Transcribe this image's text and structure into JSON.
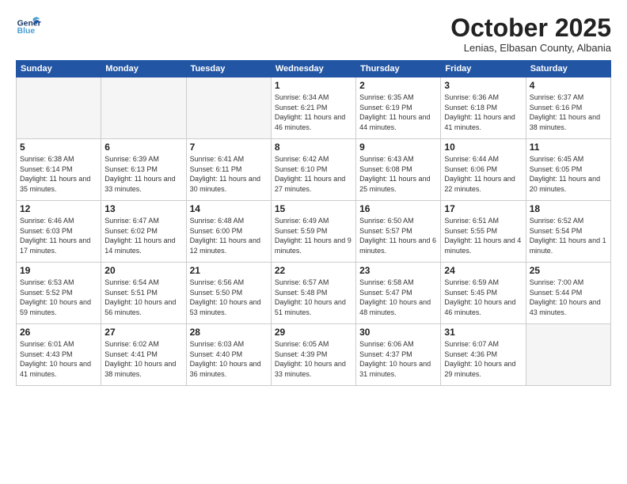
{
  "header": {
    "logo_general": "General",
    "logo_blue": "Blue",
    "month": "October 2025",
    "location": "Lenias, Elbasan County, Albania"
  },
  "weekdays": [
    "Sunday",
    "Monday",
    "Tuesday",
    "Wednesday",
    "Thursday",
    "Friday",
    "Saturday"
  ],
  "weeks": [
    [
      {
        "day": "",
        "sunrise": "",
        "sunset": "",
        "daylight": ""
      },
      {
        "day": "",
        "sunrise": "",
        "sunset": "",
        "daylight": ""
      },
      {
        "day": "",
        "sunrise": "",
        "sunset": "",
        "daylight": ""
      },
      {
        "day": "1",
        "sunrise": "Sunrise: 6:34 AM",
        "sunset": "Sunset: 6:21 PM",
        "daylight": "Daylight: 11 hours and 46 minutes."
      },
      {
        "day": "2",
        "sunrise": "Sunrise: 6:35 AM",
        "sunset": "Sunset: 6:19 PM",
        "daylight": "Daylight: 11 hours and 44 minutes."
      },
      {
        "day": "3",
        "sunrise": "Sunrise: 6:36 AM",
        "sunset": "Sunset: 6:18 PM",
        "daylight": "Daylight: 11 hours and 41 minutes."
      },
      {
        "day": "4",
        "sunrise": "Sunrise: 6:37 AM",
        "sunset": "Sunset: 6:16 PM",
        "daylight": "Daylight: 11 hours and 38 minutes."
      }
    ],
    [
      {
        "day": "5",
        "sunrise": "Sunrise: 6:38 AM",
        "sunset": "Sunset: 6:14 PM",
        "daylight": "Daylight: 11 hours and 35 minutes."
      },
      {
        "day": "6",
        "sunrise": "Sunrise: 6:39 AM",
        "sunset": "Sunset: 6:13 PM",
        "daylight": "Daylight: 11 hours and 33 minutes."
      },
      {
        "day": "7",
        "sunrise": "Sunrise: 6:41 AM",
        "sunset": "Sunset: 6:11 PM",
        "daylight": "Daylight: 11 hours and 30 minutes."
      },
      {
        "day": "8",
        "sunrise": "Sunrise: 6:42 AM",
        "sunset": "Sunset: 6:10 PM",
        "daylight": "Daylight: 11 hours and 27 minutes."
      },
      {
        "day": "9",
        "sunrise": "Sunrise: 6:43 AM",
        "sunset": "Sunset: 6:08 PM",
        "daylight": "Daylight: 11 hours and 25 minutes."
      },
      {
        "day": "10",
        "sunrise": "Sunrise: 6:44 AM",
        "sunset": "Sunset: 6:06 PM",
        "daylight": "Daylight: 11 hours and 22 minutes."
      },
      {
        "day": "11",
        "sunrise": "Sunrise: 6:45 AM",
        "sunset": "Sunset: 6:05 PM",
        "daylight": "Daylight: 11 hours and 20 minutes."
      }
    ],
    [
      {
        "day": "12",
        "sunrise": "Sunrise: 6:46 AM",
        "sunset": "Sunset: 6:03 PM",
        "daylight": "Daylight: 11 hours and 17 minutes."
      },
      {
        "day": "13",
        "sunrise": "Sunrise: 6:47 AM",
        "sunset": "Sunset: 6:02 PM",
        "daylight": "Daylight: 11 hours and 14 minutes."
      },
      {
        "day": "14",
        "sunrise": "Sunrise: 6:48 AM",
        "sunset": "Sunset: 6:00 PM",
        "daylight": "Daylight: 11 hours and 12 minutes."
      },
      {
        "day": "15",
        "sunrise": "Sunrise: 6:49 AM",
        "sunset": "Sunset: 5:59 PM",
        "daylight": "Daylight: 11 hours and 9 minutes."
      },
      {
        "day": "16",
        "sunrise": "Sunrise: 6:50 AM",
        "sunset": "Sunset: 5:57 PM",
        "daylight": "Daylight: 11 hours and 6 minutes."
      },
      {
        "day": "17",
        "sunrise": "Sunrise: 6:51 AM",
        "sunset": "Sunset: 5:55 PM",
        "daylight": "Daylight: 11 hours and 4 minutes."
      },
      {
        "day": "18",
        "sunrise": "Sunrise: 6:52 AM",
        "sunset": "Sunset: 5:54 PM",
        "daylight": "Daylight: 11 hours and 1 minute."
      }
    ],
    [
      {
        "day": "19",
        "sunrise": "Sunrise: 6:53 AM",
        "sunset": "Sunset: 5:52 PM",
        "daylight": "Daylight: 10 hours and 59 minutes."
      },
      {
        "day": "20",
        "sunrise": "Sunrise: 6:54 AM",
        "sunset": "Sunset: 5:51 PM",
        "daylight": "Daylight: 10 hours and 56 minutes."
      },
      {
        "day": "21",
        "sunrise": "Sunrise: 6:56 AM",
        "sunset": "Sunset: 5:50 PM",
        "daylight": "Daylight: 10 hours and 53 minutes."
      },
      {
        "day": "22",
        "sunrise": "Sunrise: 6:57 AM",
        "sunset": "Sunset: 5:48 PM",
        "daylight": "Daylight: 10 hours and 51 minutes."
      },
      {
        "day": "23",
        "sunrise": "Sunrise: 6:58 AM",
        "sunset": "Sunset: 5:47 PM",
        "daylight": "Daylight: 10 hours and 48 minutes."
      },
      {
        "day": "24",
        "sunrise": "Sunrise: 6:59 AM",
        "sunset": "Sunset: 5:45 PM",
        "daylight": "Daylight: 10 hours and 46 minutes."
      },
      {
        "day": "25",
        "sunrise": "Sunrise: 7:00 AM",
        "sunset": "Sunset: 5:44 PM",
        "daylight": "Daylight: 10 hours and 43 minutes."
      }
    ],
    [
      {
        "day": "26",
        "sunrise": "Sunrise: 6:01 AM",
        "sunset": "Sunset: 4:43 PM",
        "daylight": "Daylight: 10 hours and 41 minutes."
      },
      {
        "day": "27",
        "sunrise": "Sunrise: 6:02 AM",
        "sunset": "Sunset: 4:41 PM",
        "daylight": "Daylight: 10 hours and 38 minutes."
      },
      {
        "day": "28",
        "sunrise": "Sunrise: 6:03 AM",
        "sunset": "Sunset: 4:40 PM",
        "daylight": "Daylight: 10 hours and 36 minutes."
      },
      {
        "day": "29",
        "sunrise": "Sunrise: 6:05 AM",
        "sunset": "Sunset: 4:39 PM",
        "daylight": "Daylight: 10 hours and 33 minutes."
      },
      {
        "day": "30",
        "sunrise": "Sunrise: 6:06 AM",
        "sunset": "Sunset: 4:37 PM",
        "daylight": "Daylight: 10 hours and 31 minutes."
      },
      {
        "day": "31",
        "sunrise": "Sunrise: 6:07 AM",
        "sunset": "Sunset: 4:36 PM",
        "daylight": "Daylight: 10 hours and 29 minutes."
      },
      {
        "day": "",
        "sunrise": "",
        "sunset": "",
        "daylight": ""
      }
    ]
  ]
}
